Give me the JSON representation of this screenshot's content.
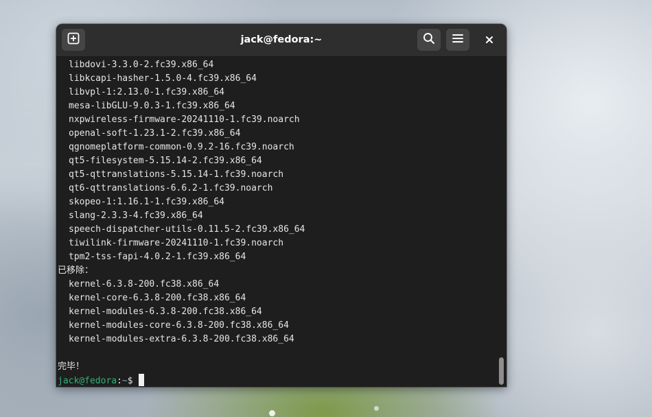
{
  "window": {
    "title": "jack@fedora:~"
  },
  "icons": {
    "new_tab": "new-tab-plus-icon",
    "search": "search-icon",
    "menu": "hamburger-menu-icon",
    "close": "close-icon"
  },
  "colors": {
    "terminal_bg": "#1e1e1e",
    "headerbar_bg": "#2e2e2e",
    "button_bg": "#454545",
    "prompt_user": "#33b07a",
    "prompt_path": "#7fa7d6",
    "text": "#e6e6e6"
  },
  "terminal": {
    "lines": [
      {
        "text": "libdovi-3.3.0-2.fc39.x86_64",
        "indent": true
      },
      {
        "text": "libkcapi-hasher-1.5.0-4.fc39.x86_64",
        "indent": true
      },
      {
        "text": "libvpl-1:2.13.0-1.fc39.x86_64",
        "indent": true
      },
      {
        "text": "mesa-libGLU-9.0.3-1.fc39.x86_64",
        "indent": true
      },
      {
        "text": "nxpwireless-firmware-20241110-1.fc39.noarch",
        "indent": true
      },
      {
        "text": "openal-soft-1.23.1-2.fc39.x86_64",
        "indent": true
      },
      {
        "text": "qgnomeplatform-common-0.9.2-16.fc39.noarch",
        "indent": true
      },
      {
        "text": "qt5-filesystem-5.15.14-2.fc39.x86_64",
        "indent": true
      },
      {
        "text": "qt5-qttranslations-5.15.14-1.fc39.noarch",
        "indent": true
      },
      {
        "text": "qt6-qttranslations-6.6.2-1.fc39.noarch",
        "indent": true
      },
      {
        "text": "skopeo-1:1.16.1-1.fc39.x86_64",
        "indent": true
      },
      {
        "text": "slang-2.3.3-4.fc39.x86_64",
        "indent": true
      },
      {
        "text": "speech-dispatcher-utils-0.11.5-2.fc39.x86_64",
        "indent": true
      },
      {
        "text": "tiwilink-firmware-20241110-1.fc39.noarch",
        "indent": true
      },
      {
        "text": "tpm2-tss-fapi-4.0.2-1.fc39.x86_64",
        "indent": true
      },
      {
        "text": "已移除：",
        "indent": false
      },
      {
        "text": "kernel-6.3.8-200.fc38.x86_64",
        "indent": true
      },
      {
        "text": "kernel-core-6.3.8-200.fc38.x86_64",
        "indent": true
      },
      {
        "text": "kernel-modules-6.3.8-200.fc38.x86_64",
        "indent": true
      },
      {
        "text": "kernel-modules-core-6.3.8-200.fc38.x86_64",
        "indent": true
      },
      {
        "text": "kernel-modules-extra-6.3.8-200.fc38.x86_64",
        "indent": true
      },
      {
        "text": "",
        "indent": false
      },
      {
        "text": "完毕！",
        "indent": false
      }
    ],
    "prompt": {
      "user_host": "jack@fedora",
      "separator": ":",
      "path": "~",
      "symbol": "$"
    }
  }
}
